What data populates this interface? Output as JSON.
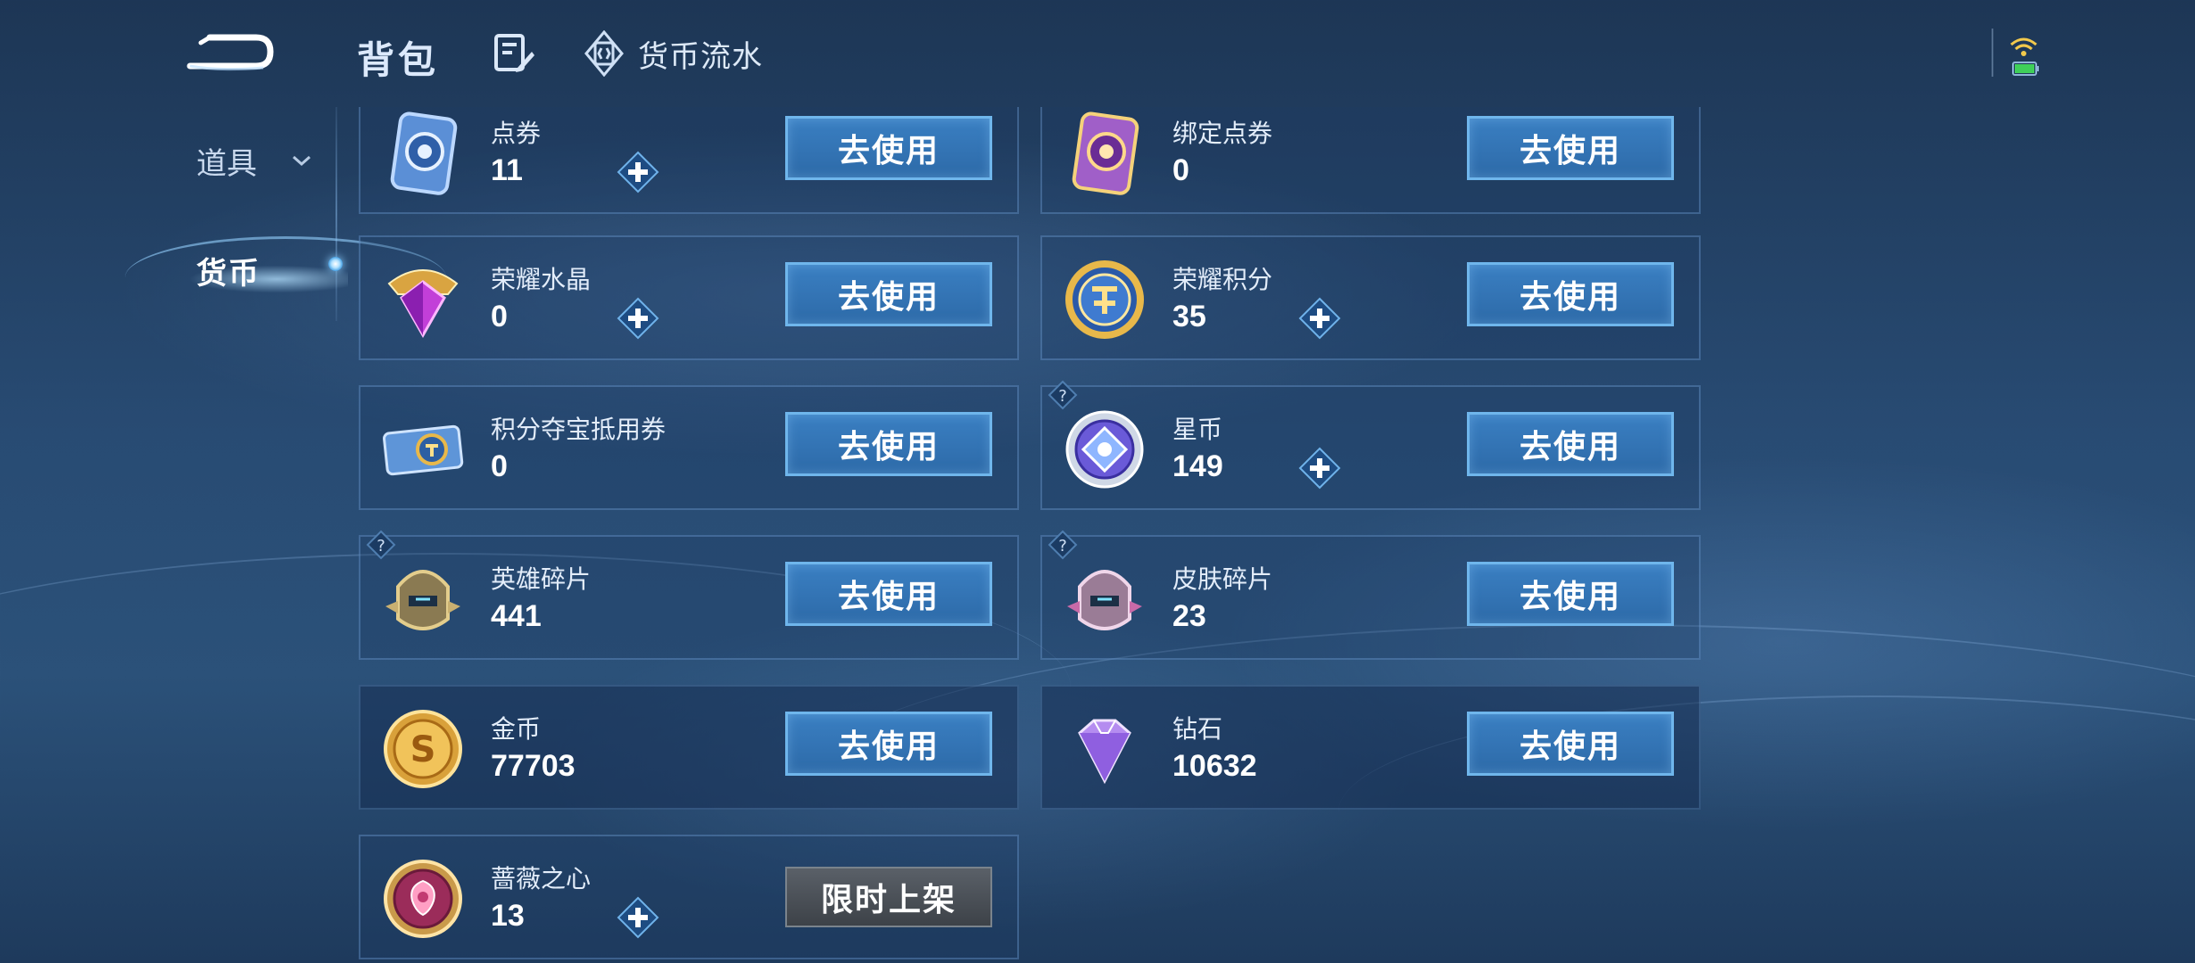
{
  "header": {
    "title": "背包",
    "currency_flow_label": "货币流水"
  },
  "sidebar": {
    "items": [
      {
        "label": "道具"
      },
      {
        "label": "货币"
      }
    ]
  },
  "cards": [
    {
      "name": "点券",
      "count": "11",
      "plus": true,
      "button": "去使用",
      "icon": "ticket-blue-icon"
    },
    {
      "name": "绑定点券",
      "count": "0",
      "plus": false,
      "button": "去使用",
      "icon": "ticket-purple-icon"
    },
    {
      "name": "荣耀水晶",
      "count": "0",
      "plus": true,
      "button": "去使用",
      "icon": "glory-crystal-icon"
    },
    {
      "name": "荣耀积分",
      "count": "35",
      "plus": true,
      "button": "去使用",
      "icon": "glory-points-icon"
    },
    {
      "name": "积分夺宝抵用券",
      "count": "0",
      "plus": false,
      "button": "去使用",
      "icon": "points-voucher-icon"
    },
    {
      "name": "星币",
      "count": "149",
      "plus": true,
      "button": "去使用",
      "icon": "star-coin-icon"
    },
    {
      "name": "英雄碎片",
      "count": "441",
      "plus": false,
      "button": "去使用",
      "icon": "hero-fragment-icon"
    },
    {
      "name": "皮肤碎片",
      "count": "23",
      "plus": false,
      "button": "去使用",
      "icon": "skin-fragment-icon"
    },
    {
      "name": "金币",
      "count": "77703",
      "plus": false,
      "button": "去使用",
      "icon": "gold-coin-icon"
    },
    {
      "name": "钻石",
      "count": "10632",
      "plus": false,
      "button": "去使用",
      "icon": "diamond-icon"
    },
    {
      "name": "蔷薇之心",
      "count": "13",
      "plus": true,
      "button": "限时上架",
      "icon": "rose-heart-icon"
    }
  ]
}
